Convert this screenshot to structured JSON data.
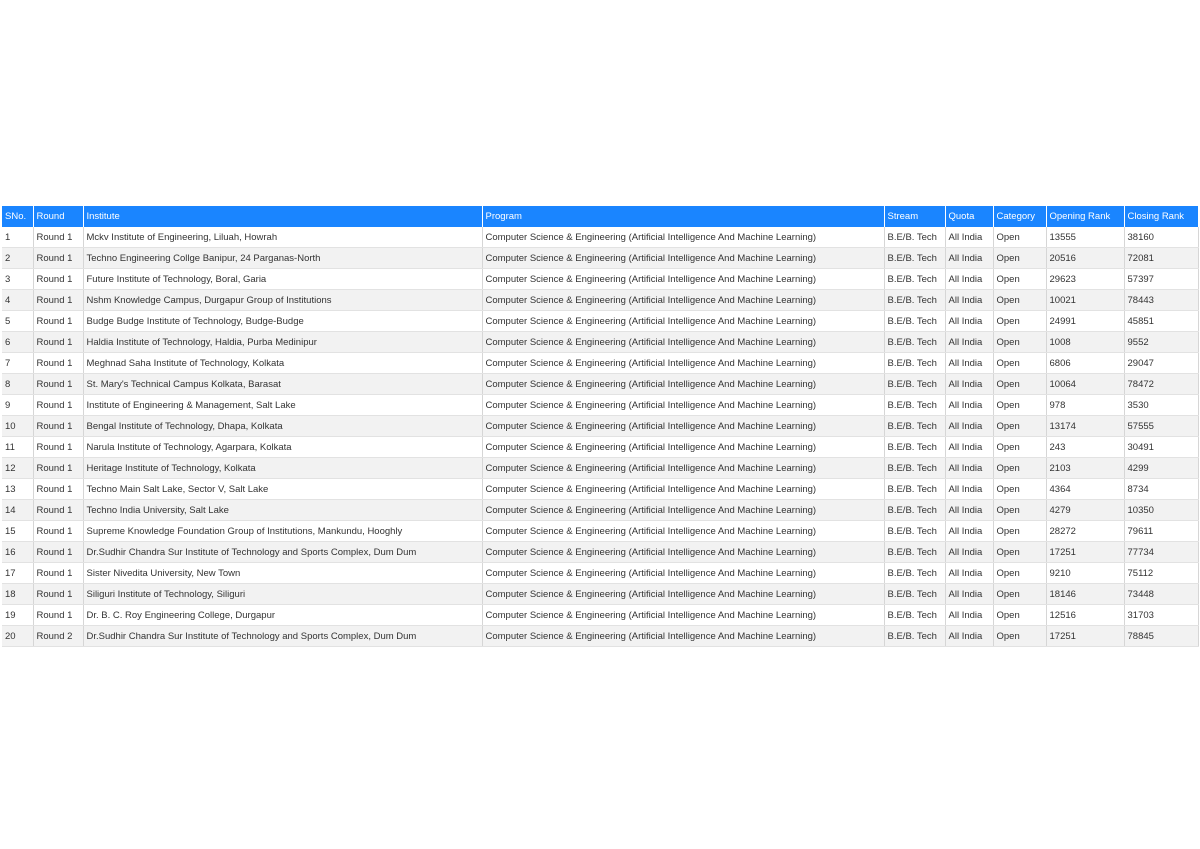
{
  "table": {
    "headers": [
      "SNo.",
      "Round",
      "Institute",
      "Program",
      "Stream",
      "Quota",
      "Category",
      "Opening Rank",
      "Closing Rank"
    ],
    "rows": [
      [
        "1",
        "Round 1",
        "Mckv Institute of Engineering, Liluah, Howrah",
        "Computer Science & Engineering (Artificial Intelligence And Machine Learning)",
        "B.E/B. Tech",
        "All India",
        "Open",
        "13555",
        "38160"
      ],
      [
        "2",
        "Round 1",
        "Techno Engineering Collge Banipur, 24 Parganas-North",
        "Computer Science & Engineering (Artificial Intelligence And Machine Learning)",
        "B.E/B. Tech",
        "All India",
        "Open",
        "20516",
        "72081"
      ],
      [
        "3",
        "Round 1",
        "Future Institute of Technology, Boral, Garia",
        "Computer Science & Engineering (Artificial Intelligence And Machine Learning)",
        "B.E/B. Tech",
        "All India",
        "Open",
        "29623",
        "57397"
      ],
      [
        "4",
        "Round 1",
        "Nshm Knowledge Campus, Durgapur Group of Institutions",
        "Computer Science & Engineering (Artificial Intelligence And Machine Learning)",
        "B.E/B. Tech",
        "All India",
        "Open",
        "10021",
        "78443"
      ],
      [
        "5",
        "Round 1",
        "Budge Budge Institute of Technology, Budge-Budge",
        "Computer Science & Engineering (Artificial Intelligence And Machine Learning)",
        "B.E/B. Tech",
        "All India",
        "Open",
        "24991",
        "45851"
      ],
      [
        "6",
        "Round 1",
        "Haldia Institute of Technology, Haldia, Purba Medinipur",
        "Computer Science & Engineering (Artificial Intelligence And Machine Learning)",
        "B.E/B. Tech",
        "All India",
        "Open",
        "1008",
        "9552"
      ],
      [
        "7",
        "Round 1",
        "Meghnad Saha Institute of Technology, Kolkata",
        "Computer Science & Engineering (Artificial Intelligence And Machine Learning)",
        "B.E/B. Tech",
        "All India",
        "Open",
        "6806",
        "29047"
      ],
      [
        "8",
        "Round 1",
        "St. Mary's Technical Campus Kolkata, Barasat",
        "Computer Science & Engineering (Artificial Intelligence And Machine Learning)",
        "B.E/B. Tech",
        "All India",
        "Open",
        "10064",
        "78472"
      ],
      [
        "9",
        "Round 1",
        "Institute of Engineering & Management, Salt Lake",
        "Computer Science & Engineering (Artificial Intelligence And Machine Learning)",
        "B.E/B. Tech",
        "All India",
        "Open",
        "978",
        "3530"
      ],
      [
        "10",
        "Round 1",
        "Bengal Institute of Technology, Dhapa, Kolkata",
        "Computer Science & Engineering (Artificial Intelligence And Machine Learning)",
        "B.E/B. Tech",
        "All India",
        "Open",
        "13174",
        "57555"
      ],
      [
        "11",
        "Round 1",
        "Narula Institute of Technology, Agarpara, Kolkata",
        "Computer Science & Engineering (Artificial Intelligence And Machine Learning)",
        "B.E/B. Tech",
        "All India",
        "Open",
        "243",
        "30491"
      ],
      [
        "12",
        "Round 1",
        "Heritage Institute of Technology, Kolkata",
        "Computer Science & Engineering (Artificial Intelligence And Machine Learning)",
        "B.E/B. Tech",
        "All India",
        "Open",
        "2103",
        "4299"
      ],
      [
        "13",
        "Round 1",
        "Techno Main Salt Lake, Sector V, Salt Lake",
        "Computer Science & Engineering (Artificial Intelligence And Machine Learning)",
        "B.E/B. Tech",
        "All India",
        "Open",
        "4364",
        "8734"
      ],
      [
        "14",
        "Round 1",
        "Techno India University, Salt Lake",
        "Computer Science & Engineering (Artificial Intelligence And Machine Learning)",
        "B.E/B. Tech",
        "All India",
        "Open",
        "4279",
        "10350"
      ],
      [
        "15",
        "Round 1",
        "Supreme Knowledge Foundation Group of Institutions, Mankundu, Hooghly",
        "Computer Science & Engineering (Artificial Intelligence And Machine Learning)",
        "B.E/B. Tech",
        "All India",
        "Open",
        "28272",
        "79611"
      ],
      [
        "16",
        "Round 1",
        "Dr.Sudhir Chandra Sur Institute of Technology and Sports Complex, Dum Dum",
        "Computer Science & Engineering (Artificial Intelligence And Machine Learning)",
        "B.E/B. Tech",
        "All India",
        "Open",
        "17251",
        "77734"
      ],
      [
        "17",
        "Round 1",
        "Sister Nivedita University, New Town",
        "Computer Science & Engineering (Artificial Intelligence And Machine Learning)",
        "B.E/B. Tech",
        "All India",
        "Open",
        "9210",
        "75112"
      ],
      [
        "18",
        "Round 1",
        "Siliguri Institute of Technology, Siliguri",
        "Computer Science & Engineering (Artificial Intelligence And Machine Learning)",
        "B.E/B. Tech",
        "All India",
        "Open",
        "18146",
        "73448"
      ],
      [
        "19",
        "Round 1",
        "Dr. B. C. Roy Engineering College, Durgapur",
        "Computer Science & Engineering (Artificial Intelligence And Machine Learning)",
        "B.E/B. Tech",
        "All India",
        "Open",
        "12516",
        "31703"
      ],
      [
        "20",
        "Round 2",
        "Dr.Sudhir Chandra Sur Institute of Technology and Sports Complex, Dum Dum",
        "Computer Science & Engineering (Artificial Intelligence And Machine Learning)",
        "B.E/B. Tech",
        "All India",
        "Open",
        "17251",
        "78845"
      ]
    ]
  },
  "colors": {
    "header_bg": "#1a85ff",
    "header_text": "#ffffff",
    "row_alt_bg": "#f2f2f2"
  }
}
